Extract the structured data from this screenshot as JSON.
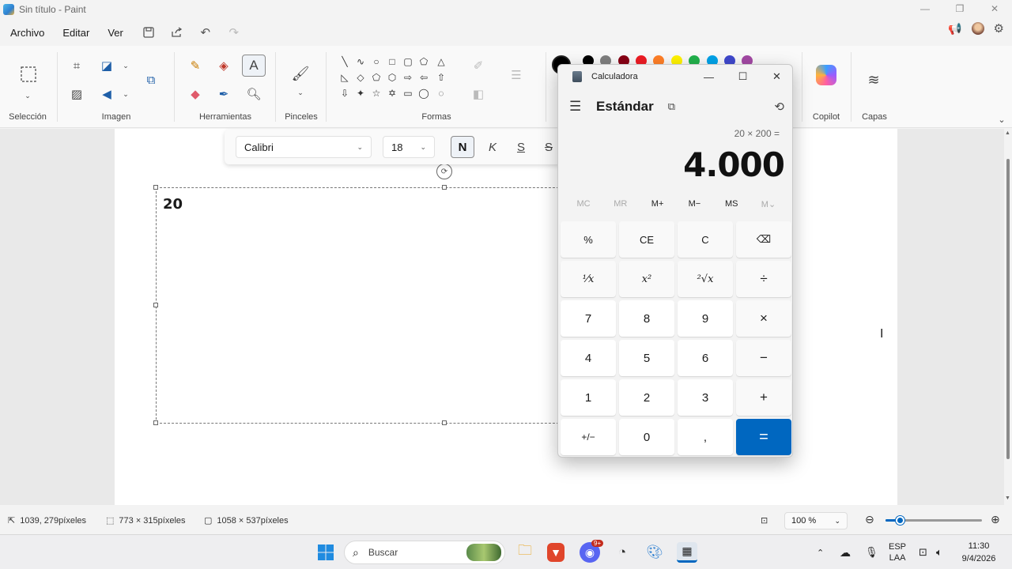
{
  "window": {
    "title": "Sin título - Paint"
  },
  "menu": {
    "file": "Archivo",
    "edit": "Editar",
    "view": "Ver"
  },
  "ribbon": {
    "groups": {
      "selection": "Selección",
      "image": "Imagen",
      "tools": "Herramientas",
      "brushes": "Pinceles",
      "shapes": "Formas",
      "copilot": "Copilot",
      "layers": "Capas"
    },
    "colors": [
      "#000000",
      "#7f7f7f",
      "#880015",
      "#ed1c24",
      "#ff7f27",
      "#fff200",
      "#22b14c",
      "#00a2e8",
      "#3f48cc",
      "#a349a4"
    ]
  },
  "text_toolbar": {
    "font": "Calibri",
    "size": "18",
    "bold": "N",
    "italic": "K",
    "underline": "S",
    "strike": "S"
  },
  "canvas": {
    "text": "20"
  },
  "status": {
    "cursor": "1039, 279píxeles",
    "selection": "773 × 315píxeles",
    "canvas_size": "1058 × 537píxeles",
    "zoom": "100 %",
    "zoom_level": 0.15
  },
  "calculator": {
    "title": "Calculadora",
    "mode": "Estándar",
    "expression": "20 × 200 =",
    "result": "4.000",
    "memory": [
      "MC",
      "MR",
      "M+",
      "M−",
      "MS",
      "M⌄"
    ],
    "keys": [
      [
        "%",
        "CE",
        "C",
        "⌫"
      ],
      [
        "¹⁄x",
        "x²",
        "²√x",
        "÷"
      ],
      [
        "7",
        "8",
        "9",
        "×"
      ],
      [
        "4",
        "5",
        "6",
        "−"
      ],
      [
        "1",
        "2",
        "3",
        "+"
      ],
      [
        "+/−",
        "0",
        ",",
        "="
      ]
    ]
  },
  "taskbar": {
    "search": "Buscar",
    "lang": "ESP",
    "lang2": "LAA",
    "time": "11:30",
    "date": "9/4/2026",
    "badge": "9+"
  }
}
